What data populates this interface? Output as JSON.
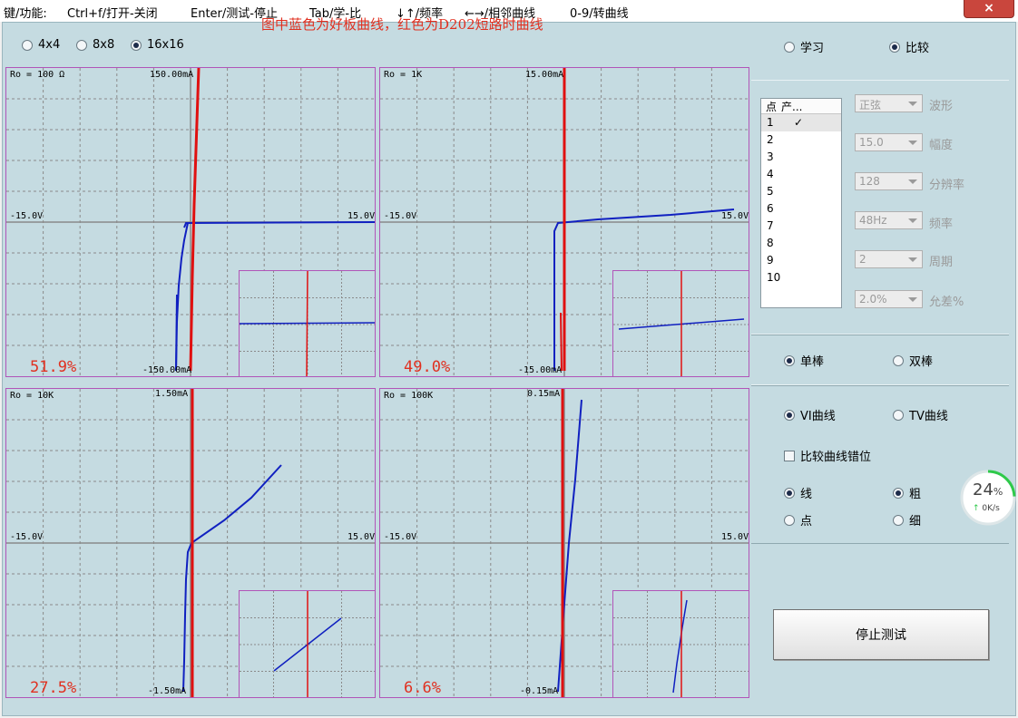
{
  "menu": [
    "键/功能:",
    "Ctrl+f/打开-关闭",
    "Enter/测试-停止",
    "Tab/学-比",
    "↓↑/频率",
    "←→/相邻曲线",
    "0-9/转曲线"
  ],
  "close_icon": "×",
  "grid_options": [
    "4x4",
    "8x8",
    "16x16"
  ],
  "grid_selected": "16x16",
  "headline": "图中蓝色为好板曲线，红色为D202短路时曲线",
  "mode_options": [
    "学习",
    "比较"
  ],
  "mode_selected": "比较",
  "panels": [
    {
      "ro": "Ro = 100 Ω",
      "top": "150.00mA",
      "bottom": "-150.00mA",
      "left": "-15.0V",
      "right": "15.0V",
      "pct": "51.9%"
    },
    {
      "ro": "Ro = 1K",
      "top": "15.00mA",
      "bottom": "-15.00mA",
      "left": "-15.0V",
      "right": "15.0V",
      "pct": "49.0%"
    },
    {
      "ro": "Ro = 10K",
      "top": "1.50mA",
      "bottom": "-1.50mA",
      "left": "-15.0V",
      "right": "15.0V",
      "pct": "27.5%"
    },
    {
      "ro": "Ro = 100K",
      "top": "0.15mA",
      "bottom": "-0.15mA",
      "left": "-15.0V",
      "right": "15.0V",
      "pct": "6.6%"
    }
  ],
  "point_table": {
    "headers": [
      "点",
      "产..."
    ],
    "rows": [
      "1",
      "2",
      "3",
      "4",
      "5",
      "6",
      "7",
      "8",
      "9",
      "10"
    ],
    "row1_mark": "✓"
  },
  "settings": [
    {
      "value": "正弦",
      "label": "波形"
    },
    {
      "value": "15.0",
      "label": "幅度"
    },
    {
      "value": "128",
      "label": "分辨率"
    },
    {
      "value": "48Hz",
      "label": "频率"
    },
    {
      "value": "2",
      "label": "周期"
    },
    {
      "value": "2.0%",
      "label": "允差%"
    }
  ],
  "probe_options": [
    "单棒",
    "双棒"
  ],
  "probe_selected": "单棒",
  "curve_options": [
    "VI曲线",
    "TV曲线"
  ],
  "curve_selected": "VI曲线",
  "offset_checkbox": "比较曲线错位",
  "offset_checked": false,
  "style_options": [
    "线",
    "点"
  ],
  "style_selected": "线",
  "weight_options": [
    "粗",
    "细"
  ],
  "weight_selected": "粗",
  "stop_button": "停止测试",
  "gauge": {
    "value": "24",
    "unit": "%",
    "speed": "0K/s",
    "up_arrow": "↑"
  },
  "colors": {
    "good_curve": "#1020c0",
    "short_curve": "#e01010",
    "background": "#c5dbe1",
    "border": "#b155b8"
  }
}
